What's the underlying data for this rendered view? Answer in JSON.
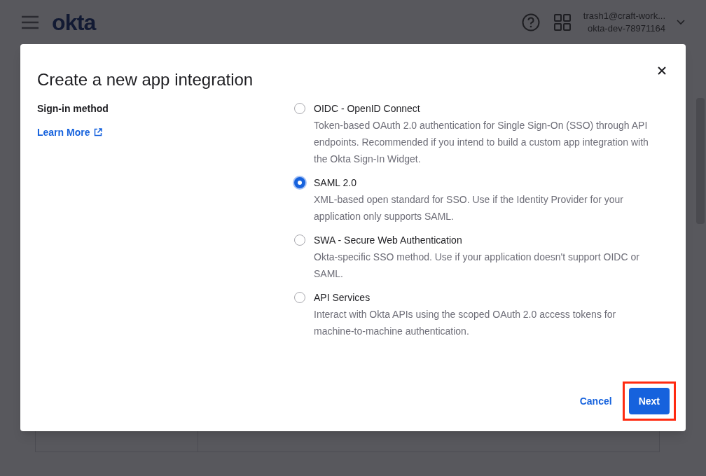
{
  "header": {
    "logo": "okta",
    "user_email": "trash1@craft-work...",
    "org": "okta-dev-78971164"
  },
  "dialog": {
    "title": "Create a new app integration",
    "section_label": "Sign-in method",
    "learn_more": "Learn More",
    "options": [
      {
        "label": "OIDC - OpenID Connect",
        "description": "Token-based OAuth 2.0 authentication for Single Sign-On (SSO) through API endpoints. Recommended if you intend to build a custom app integration with the Okta Sign-In Widget.",
        "selected": false
      },
      {
        "label": "SAML 2.0",
        "description": "XML-based open standard for SSO. Use if the Identity Provider for your application only supports SAML.",
        "selected": true
      },
      {
        "label": "SWA - Secure Web Authentication",
        "description": "Okta-specific SSO method. Use if your application doesn't support OIDC or SAML.",
        "selected": false
      },
      {
        "label": "API Services",
        "description": "Interact with Okta APIs using the scoped OAuth 2.0 access tokens for machine-to-machine authentication.",
        "selected": false
      }
    ],
    "cancel_button": "Cancel",
    "next_button": "Next",
    "next_highlighted": true
  }
}
